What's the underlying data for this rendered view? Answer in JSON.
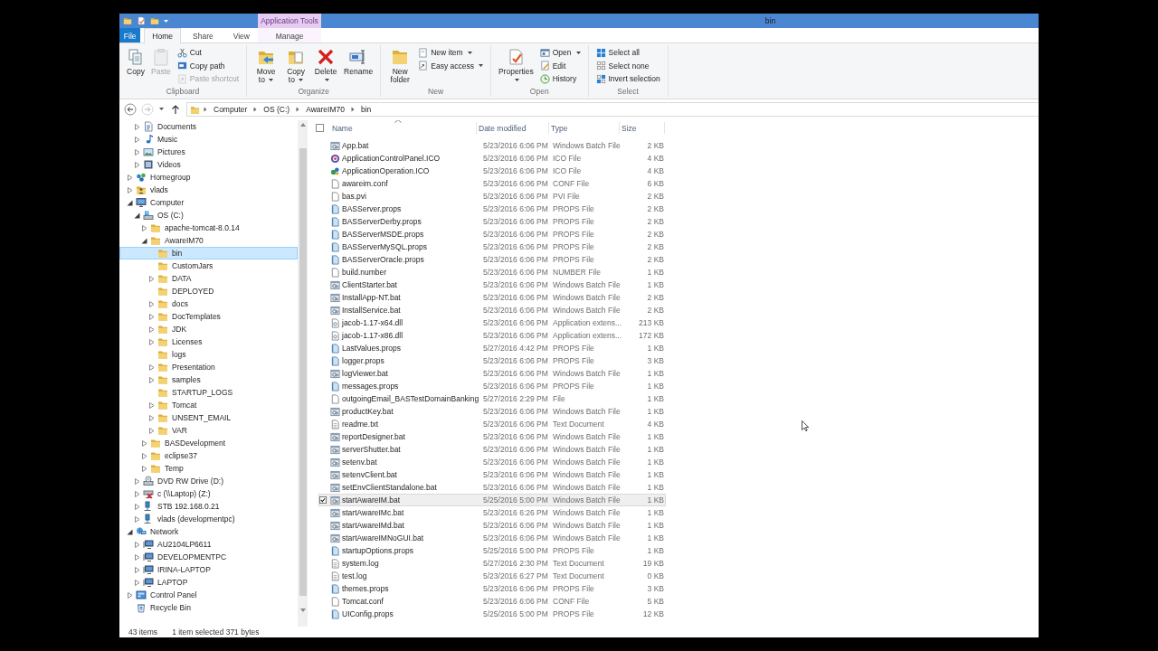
{
  "title_bar": {
    "context_tab": "Application Tools",
    "title": "bin"
  },
  "ribbon_tabs": [
    {
      "label": "File",
      "kind": "file",
      "selected": false
    },
    {
      "label": "Home",
      "kind": "tab",
      "selected": true
    },
    {
      "label": "Share",
      "kind": "tab",
      "selected": false
    },
    {
      "label": "View",
      "kind": "tab",
      "selected": false
    },
    {
      "label": "Manage",
      "kind": "context",
      "selected": false
    }
  ],
  "ribbon_groups": [
    {
      "label": "Clipboard",
      "commands": [
        {
          "label": "Copy",
          "kind": "large",
          "dropdown": false,
          "disabled": false
        },
        {
          "label": "Paste",
          "kind": "large",
          "dropdown": false,
          "disabled": true
        },
        {
          "label": "Cut",
          "kind": "small",
          "dropdown": false,
          "disabled": false
        },
        {
          "label": "Copy path",
          "kind": "small",
          "dropdown": false,
          "disabled": false
        },
        {
          "label": "Paste shortcut",
          "kind": "small",
          "dropdown": false,
          "disabled": true
        }
      ]
    },
    {
      "label": "Organize",
      "commands": [
        {
          "label": "Move to",
          "kind": "large",
          "dropdown": true,
          "disabled": false
        },
        {
          "label": "Copy to",
          "kind": "large",
          "dropdown": true,
          "disabled": false
        },
        {
          "label": "Delete",
          "kind": "large",
          "dropdown": true,
          "disabled": false
        },
        {
          "label": "Rename",
          "kind": "large",
          "dropdown": false,
          "disabled": false
        }
      ]
    },
    {
      "label": "New",
      "commands": [
        {
          "label": "New folder",
          "kind": "large",
          "dropdown": false,
          "disabled": false
        },
        {
          "label": "New item",
          "kind": "small",
          "dropdown": true,
          "disabled": false
        },
        {
          "label": "Easy access",
          "kind": "small",
          "dropdown": true,
          "disabled": false
        }
      ]
    },
    {
      "label": "Open",
      "commands": [
        {
          "label": "Properties",
          "kind": "large",
          "dropdown": true,
          "disabled": false
        },
        {
          "label": "Open",
          "kind": "small",
          "dropdown": true,
          "disabled": false
        },
        {
          "label": "Edit",
          "kind": "small",
          "dropdown": false,
          "disabled": false
        },
        {
          "label": "History",
          "kind": "small",
          "dropdown": false,
          "disabled": false
        }
      ]
    },
    {
      "label": "Select",
      "commands": [
        {
          "label": "Select all",
          "kind": "small",
          "dropdown": false,
          "disabled": false
        },
        {
          "label": "Select none",
          "kind": "small",
          "dropdown": false,
          "disabled": false
        },
        {
          "label": "Invert selection",
          "kind": "small",
          "dropdown": false,
          "disabled": false
        }
      ]
    }
  ],
  "navigation": [
    {
      "kind": "back",
      "disabled": false
    },
    {
      "kind": "forward",
      "disabled": true
    },
    {
      "kind": "recent",
      "disabled": false
    },
    {
      "kind": "up",
      "disabled": false
    }
  ],
  "address": {
    "crumbs": [
      "Computer",
      "OS (C:)",
      "AwareIM70",
      "bin"
    ]
  },
  "tree": {
    "scrolled_items": [
      {
        "label": "Documents",
        "kind": "documents",
        "expandable": true,
        "expanded": false,
        "selected": false
      },
      {
        "label": "Music",
        "kind": "music",
        "expandable": true,
        "expanded": false,
        "selected": false
      },
      {
        "label": "Pictures",
        "kind": "pictures",
        "expandable": true,
        "expanded": false,
        "selected": false
      },
      {
        "label": "Videos",
        "kind": "videos",
        "expandable": true,
        "expanded": false,
        "selected": false
      }
    ],
    "items": [
      {
        "label": "Homegroup",
        "kind": "homegroup",
        "expandable": true,
        "expanded": false,
        "selected": false
      },
      {
        "label": "vlads",
        "kind": "user",
        "expandable": true,
        "expanded": false,
        "selected": false
      },
      {
        "label": "Computer",
        "kind": "computer",
        "expandable": true,
        "expanded": true,
        "selected": false,
        "children": [
          {
            "label": "OS (C:)",
            "kind": "drive",
            "expandable": true,
            "expanded": true,
            "selected": false,
            "children": [
              {
                "label": "apache-tomcat-8.0.14",
                "kind": "folder",
                "expandable": true,
                "expanded": false,
                "selected": false
              },
              {
                "label": "AwareIM70",
                "kind": "folder",
                "expandable": true,
                "expanded": true,
                "selected": false,
                "children": [
                  {
                    "label": "bin",
                    "kind": "folder",
                    "expandable": false,
                    "expanded": false,
                    "selected": true
                  },
                  {
                    "label": "CustomJars",
                    "kind": "folder",
                    "expandable": false,
                    "expanded": false,
                    "selected": false
                  },
                  {
                    "label": "DATA",
                    "kind": "folder",
                    "expandable": true,
                    "expanded": false,
                    "selected": false
                  },
                  {
                    "label": "DEPLOYED",
                    "kind": "folder",
                    "expandable": false,
                    "expanded": false,
                    "selected": false
                  },
                  {
                    "label": "docs",
                    "kind": "folder",
                    "expandable": true,
                    "expanded": false,
                    "selected": false
                  },
                  {
                    "label": "DocTemplates",
                    "kind": "folder",
                    "expandable": true,
                    "expanded": false,
                    "selected": false
                  },
                  {
                    "label": "JDK",
                    "kind": "folder",
                    "expandable": true,
                    "expanded": false,
                    "selected": false
                  },
                  {
                    "label": "Licenses",
                    "kind": "folder",
                    "expandable": true,
                    "expanded": false,
                    "selected": false
                  },
                  {
                    "label": "logs",
                    "kind": "folder",
                    "expandable": false,
                    "expanded": false,
                    "selected": false
                  },
                  {
                    "label": "Presentation",
                    "kind": "folder",
                    "expandable": true,
                    "expanded": false,
                    "selected": false
                  },
                  {
                    "label": "samples",
                    "kind": "folder",
                    "expandable": true,
                    "expanded": false,
                    "selected": false
                  },
                  {
                    "label": "STARTUP_LOGS",
                    "kind": "folder",
                    "expandable": false,
                    "expanded": false,
                    "selected": false
                  },
                  {
                    "label": "Tomcat",
                    "kind": "folder",
                    "expandable": true,
                    "expanded": false,
                    "selected": false
                  },
                  {
                    "label": "UNSENT_EMAIL",
                    "kind": "folder",
                    "expandable": true,
                    "expanded": false,
                    "selected": false
                  },
                  {
                    "label": "VAR",
                    "kind": "folder",
                    "expandable": true,
                    "expanded": false,
                    "selected": false
                  }
                ]
              },
              {
                "label": "BASDevelopment",
                "kind": "folder",
                "expandable": true,
                "expanded": false,
                "selected": false
              },
              {
                "label": "eclipse37",
                "kind": "folder",
                "expandable": true,
                "expanded": false,
                "selected": false
              },
              {
                "label": "Temp",
                "kind": "folder",
                "expandable": true,
                "expanded": false,
                "selected": false
              }
            ]
          },
          {
            "label": "DVD RW Drive (D:)",
            "kind": "dvd",
            "expandable": true,
            "expanded": false,
            "selected": false
          },
          {
            "label": "c (\\\\Laptop) (Z:)",
            "kind": "netdrive-off",
            "expandable": true,
            "expanded": false,
            "selected": false
          },
          {
            "label": "STB 192.168.0.21",
            "kind": "netdrive",
            "expandable": true,
            "expanded": false,
            "selected": false
          },
          {
            "label": "vlads (developmentpc)",
            "kind": "netdrive",
            "expandable": true,
            "expanded": false,
            "selected": false
          }
        ]
      },
      {
        "label": "Network",
        "kind": "network",
        "expandable": true,
        "expanded": true,
        "selected": false,
        "children": [
          {
            "label": "AU2104LP6611",
            "kind": "pc",
            "expandable": true,
            "expanded": false,
            "selected": false
          },
          {
            "label": "DEVELOPMENTPC",
            "kind": "pc",
            "expandable": true,
            "expanded": false,
            "selected": false
          },
          {
            "label": "IRINA-LAPTOP",
            "kind": "pc",
            "expandable": true,
            "expanded": false,
            "selected": false
          },
          {
            "label": "LAPTOP",
            "kind": "pc",
            "expandable": true,
            "expanded": false,
            "selected": false
          }
        ]
      },
      {
        "label": "Control Panel",
        "kind": "control",
        "expandable": true,
        "expanded": false,
        "selected": false
      },
      {
        "label": "Recycle Bin",
        "kind": "recycle",
        "expandable": false,
        "expanded": false,
        "selected": false
      }
    ]
  },
  "file_list": {
    "select_all_checked": false,
    "columns": [
      {
        "label": "Name",
        "sorted": true
      },
      {
        "label": "Date modified",
        "sorted": false
      },
      {
        "label": "Type",
        "sorted": false
      },
      {
        "label": "Size",
        "sorted": false
      }
    ],
    "files": [
      {
        "name": "App.bat",
        "date": "5/23/2016 6:06 PM",
        "type": "Windows Batch File",
        "size": "2 KB",
        "kind": "bat",
        "selected": false
      },
      {
        "name": "ApplicationControlPanel.ICO",
        "date": "5/23/2016 6:06 PM",
        "type": "ICO File",
        "size": "4 KB",
        "kind": "ico-round",
        "selected": false
      },
      {
        "name": "ApplicationOperation.ICO",
        "date": "5/23/2016 6:06 PM",
        "type": "ICO File",
        "size": "4 KB",
        "kind": "ico-gears",
        "selected": false
      },
      {
        "name": "awareim.conf",
        "date": "5/23/2016 6:06 PM",
        "type": "CONF File",
        "size": "6 KB",
        "kind": "blank",
        "selected": false
      },
      {
        "name": "bas.pvi",
        "date": "5/23/2016 6:06 PM",
        "type": "PVI File",
        "size": "2 KB",
        "kind": "blank",
        "selected": false
      },
      {
        "name": "BASServer.props",
        "date": "5/23/2016 6:06 PM",
        "type": "PROPS File",
        "size": "2 KB",
        "kind": "props",
        "selected": false
      },
      {
        "name": "BASServerDerby.props",
        "date": "5/23/2016 6:06 PM",
        "type": "PROPS File",
        "size": "2 KB",
        "kind": "props",
        "selected": false
      },
      {
        "name": "BASServerMSDE.props",
        "date": "5/23/2016 6:06 PM",
        "type": "PROPS File",
        "size": "2 KB",
        "kind": "props",
        "selected": false
      },
      {
        "name": "BASServerMySQL.props",
        "date": "5/23/2016 6:06 PM",
        "type": "PROPS File",
        "size": "2 KB",
        "kind": "props",
        "selected": false
      },
      {
        "name": "BASServerOracle.props",
        "date": "5/23/2016 6:06 PM",
        "type": "PROPS File",
        "size": "2 KB",
        "kind": "props",
        "selected": false
      },
      {
        "name": "build.number",
        "date": "5/23/2016 6:06 PM",
        "type": "NUMBER File",
        "size": "1 KB",
        "kind": "blank",
        "selected": false
      },
      {
        "name": "ClientStarter.bat",
        "date": "5/23/2016 6:06 PM",
        "type": "Windows Batch File",
        "size": "1 KB",
        "kind": "bat",
        "selected": false
      },
      {
        "name": "InstallApp-NT.bat",
        "date": "5/23/2016 6:06 PM",
        "type": "Windows Batch File",
        "size": "2 KB",
        "kind": "bat",
        "selected": false
      },
      {
        "name": "InstallService.bat",
        "date": "5/23/2016 6:06 PM",
        "type": "Windows Batch File",
        "size": "2 KB",
        "kind": "bat",
        "selected": false
      },
      {
        "name": "jacob-1.17-x64.dll",
        "date": "5/23/2016 6:06 PM",
        "type": "Application extens...",
        "size": "213 KB",
        "kind": "dll",
        "selected": false
      },
      {
        "name": "jacob-1.17-x86.dll",
        "date": "5/23/2016 6:06 PM",
        "type": "Application extens...",
        "size": "172 KB",
        "kind": "dll",
        "selected": false
      },
      {
        "name": "LastValues.props",
        "date": "5/27/2016 4:42 PM",
        "type": "PROPS File",
        "size": "1 KB",
        "kind": "props",
        "selected": false
      },
      {
        "name": "logger.props",
        "date": "5/23/2016 6:06 PM",
        "type": "PROPS File",
        "size": "3 KB",
        "kind": "props",
        "selected": false
      },
      {
        "name": "logViewer.bat",
        "date": "5/23/2016 6:06 PM",
        "type": "Windows Batch File",
        "size": "1 KB",
        "kind": "bat",
        "selected": false
      },
      {
        "name": "messages.props",
        "date": "5/23/2016 6:06 PM",
        "type": "PROPS File",
        "size": "1 KB",
        "kind": "props",
        "selected": false
      },
      {
        "name": "outgoingEmail_BASTestDomainBanking",
        "date": "5/27/2016 2:29 PM",
        "type": "File",
        "size": "1 KB",
        "kind": "blank",
        "selected": false
      },
      {
        "name": "productKey.bat",
        "date": "5/23/2016 6:06 PM",
        "type": "Windows Batch File",
        "size": "1 KB",
        "kind": "bat",
        "selected": false
      },
      {
        "name": "readme.txt",
        "date": "5/23/2016 6:06 PM",
        "type": "Text Document",
        "size": "4 KB",
        "kind": "text",
        "selected": false
      },
      {
        "name": "reportDesigner.bat",
        "date": "5/23/2016 6:06 PM",
        "type": "Windows Batch File",
        "size": "1 KB",
        "kind": "bat",
        "selected": false
      },
      {
        "name": "serverShutter.bat",
        "date": "5/23/2016 6:06 PM",
        "type": "Windows Batch File",
        "size": "1 KB",
        "kind": "bat",
        "selected": false
      },
      {
        "name": "setenv.bat",
        "date": "5/23/2016 6:06 PM",
        "type": "Windows Batch File",
        "size": "1 KB",
        "kind": "bat",
        "selected": false
      },
      {
        "name": "setenvClient.bat",
        "date": "5/23/2016 6:06 PM",
        "type": "Windows Batch File",
        "size": "1 KB",
        "kind": "bat",
        "selected": false
      },
      {
        "name": "setEnvClientStandalone.bat",
        "date": "5/23/2016 6:06 PM",
        "type": "Windows Batch File",
        "size": "1 KB",
        "kind": "bat",
        "selected": false
      },
      {
        "name": "startAwareIM.bat",
        "date": "5/25/2016 5:00 PM",
        "type": "Windows Batch File",
        "size": "1 KB",
        "kind": "bat",
        "selected": true
      },
      {
        "name": "startAwareIMc.bat",
        "date": "5/23/2016 6:26 PM",
        "type": "Windows Batch File",
        "size": "1 KB",
        "kind": "bat",
        "selected": false
      },
      {
        "name": "startAwareIMd.bat",
        "date": "5/23/2016 6:06 PM",
        "type": "Windows Batch File",
        "size": "1 KB",
        "kind": "bat",
        "selected": false
      },
      {
        "name": "startAwareIMNoGUI.bat",
        "date": "5/23/2016 6:06 PM",
        "type": "Windows Batch File",
        "size": "1 KB",
        "kind": "bat",
        "selected": false
      },
      {
        "name": "startupOptions.props",
        "date": "5/25/2016 5:00 PM",
        "type": "PROPS File",
        "size": "1 KB",
        "kind": "props",
        "selected": false
      },
      {
        "name": "system.log",
        "date": "5/27/2016 2:30 PM",
        "type": "Text Document",
        "size": "19 KB",
        "kind": "text",
        "selected": false
      },
      {
        "name": "test.log",
        "date": "5/23/2016 6:27 PM",
        "type": "Text Document",
        "size": "0 KB",
        "kind": "text",
        "selected": false
      },
      {
        "name": "themes.props",
        "date": "5/23/2016 6:06 PM",
        "type": "PROPS File",
        "size": "3 KB",
        "kind": "props",
        "selected": false
      },
      {
        "name": "Tomcat.conf",
        "date": "5/23/2016 6:06 PM",
        "type": "CONF File",
        "size": "5 KB",
        "kind": "blank",
        "selected": false
      },
      {
        "name": "UIConfig.props",
        "date": "5/25/2016 5:00 PM",
        "type": "PROPS File",
        "size": "12 KB",
        "kind": "props",
        "selected": false
      }
    ]
  },
  "status_bar": {
    "item_count": "43 items",
    "selection": "1 item selected 371 bytes"
  }
}
